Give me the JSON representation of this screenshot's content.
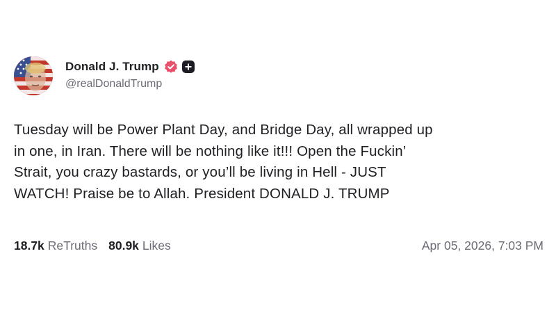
{
  "author": {
    "display_name": "Donald J. Trump",
    "handle": "@realDonaldTrump",
    "verified_color": "#e8516c"
  },
  "post": {
    "lines": [
      "Tuesday will be Power Plant Day, and Bridge Day, all wrapped up",
      "in one, in Iran. There will be nothing like it!!! Open the Fuckin’",
      "Strait, you crazy bastards, or you’ll be living in Hell - JUST",
      "WATCH! Praise be to Allah. President DONALD J. TRUMP"
    ]
  },
  "stats": {
    "retruths_count": "18.7k",
    "retruths_label": "ReTruths",
    "likes_count": "80.9k",
    "likes_label": "Likes"
  },
  "timestamp": "Apr 05, 2026, 7:03 PM"
}
